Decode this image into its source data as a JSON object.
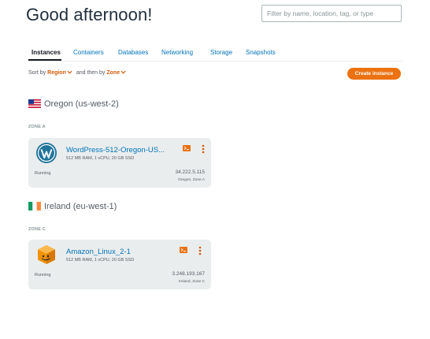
{
  "header": {
    "greeting": "Good afternoon!",
    "search_placeholder": "Filter by name, location, tag, or type"
  },
  "tabs": [
    {
      "label": "Instances",
      "active": true
    },
    {
      "label": "Containers"
    },
    {
      "label": "Databases"
    },
    {
      "label": "Networking"
    },
    {
      "label": "Storage"
    },
    {
      "label": "Snapshots"
    }
  ],
  "sort": {
    "prefix": "Sort by",
    "primary": "Region",
    "middle": "and then by",
    "secondary": "Zone"
  },
  "create_button_label": "Create instance",
  "regions": [
    {
      "name": "Oregon (us-west-2)",
      "flag": "us-flag-icon",
      "zone": "ZONE A",
      "instance": {
        "name": "WordPress-512-Oregon-US...",
        "specs": "512 MB RAM, 1 vCPU, 20 GB SSD",
        "status": "Running",
        "ip": "34.222.5.115",
        "location": "Oregon, Zone A",
        "icon": "wordpress-icon"
      }
    },
    {
      "name": "Ireland (eu-west-1)",
      "flag": "ireland-flag-icon",
      "zone": "ZONE C",
      "instance": {
        "name": "Amazon_Linux_2-1",
        "specs": "512 MB RAM, 1 vCPU, 20 GB SSD",
        "status": "Running",
        "ip": "3.248.193.167",
        "location": "Ireland, Zone C",
        "icon": "amazon-linux-icon"
      }
    }
  ],
  "colors": {
    "accent": "#ec7211",
    "link": "#0073bb",
    "card_bg": "#eaeded",
    "sort_value": "#d45b07"
  }
}
